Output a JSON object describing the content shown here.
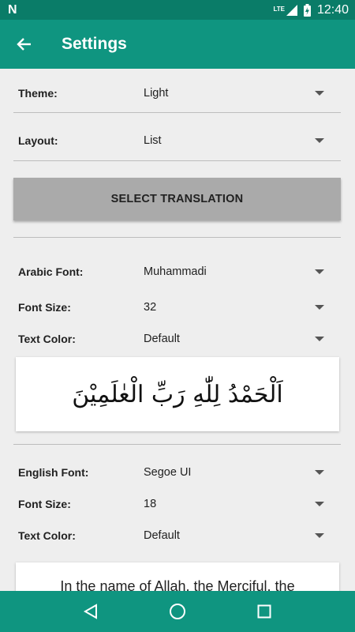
{
  "status_bar": {
    "logo": "N",
    "network": "LTE",
    "time": "12:40"
  },
  "app_bar": {
    "title": "Settings",
    "back_icon": "arrow-left-icon"
  },
  "general": {
    "theme": {
      "label": "Theme:",
      "value": "Light"
    },
    "layout": {
      "label": "Layout:",
      "value": "List"
    },
    "select_translation_label": "SELECT TRANSLATION"
  },
  "arabic": {
    "font": {
      "label": "Arabic Font:",
      "value": "Muhammadi"
    },
    "size": {
      "label": "Font Size:",
      "value": "32"
    },
    "color": {
      "label": "Text Color:",
      "value": "Default"
    },
    "preview": "اَلْحَمْدُ لِلّٰهِ رَبِّ الْعٰلَمِيْنَ"
  },
  "english": {
    "font": {
      "label": "English Font:",
      "value": "Segoe UI"
    },
    "size": {
      "label": "Font Size:",
      "value": "18"
    },
    "color": {
      "label": "Text Color:",
      "value": "Default"
    },
    "preview": "In the name of Allah, the Merciful, the"
  },
  "nav_bar": {
    "back_icon": "triangle-back-icon",
    "home_icon": "circle-home-icon",
    "recents_icon": "square-recents-icon"
  },
  "colors": {
    "status_bar": "#0a7c68",
    "app_bar": "#0f9580",
    "background": "#eeeeee",
    "button": "#aaaaaa"
  }
}
